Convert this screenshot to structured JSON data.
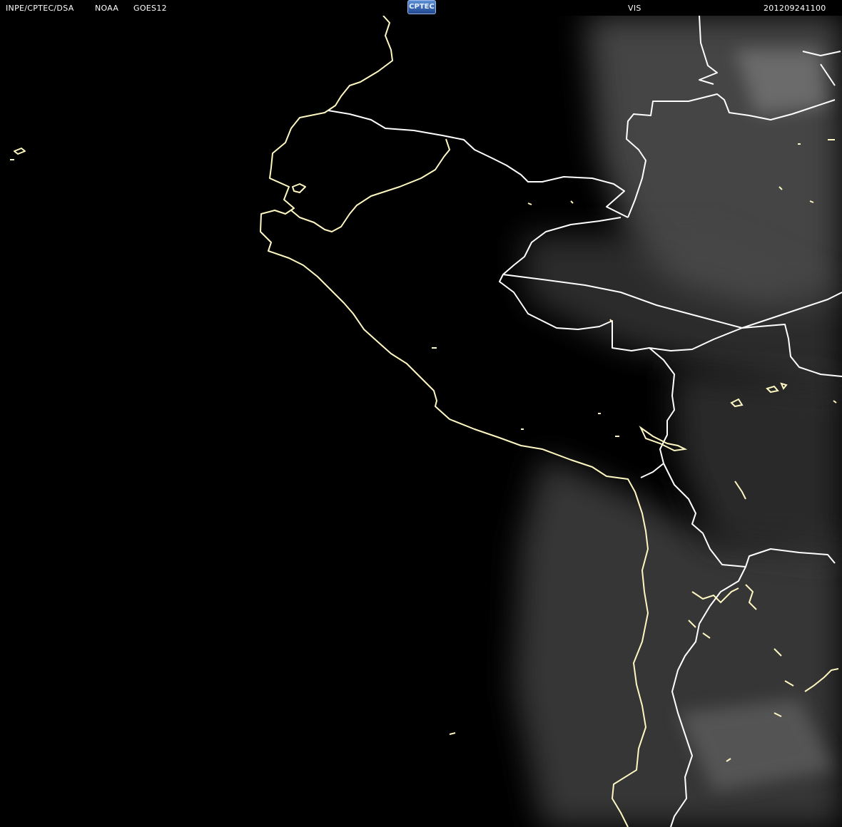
{
  "header": {
    "agency": "INPE/CPTEC/DSA",
    "source": "NOAA",
    "satellite": "GOES12",
    "logo_text": "CPTEC",
    "channel": "VIS",
    "timestamp": "201209241100"
  },
  "colors": {
    "background": "#000000",
    "header_text": "#ffffff",
    "coastline": "#fff7c2",
    "border": "#ffffff",
    "cloud": "#7a7a7a"
  }
}
